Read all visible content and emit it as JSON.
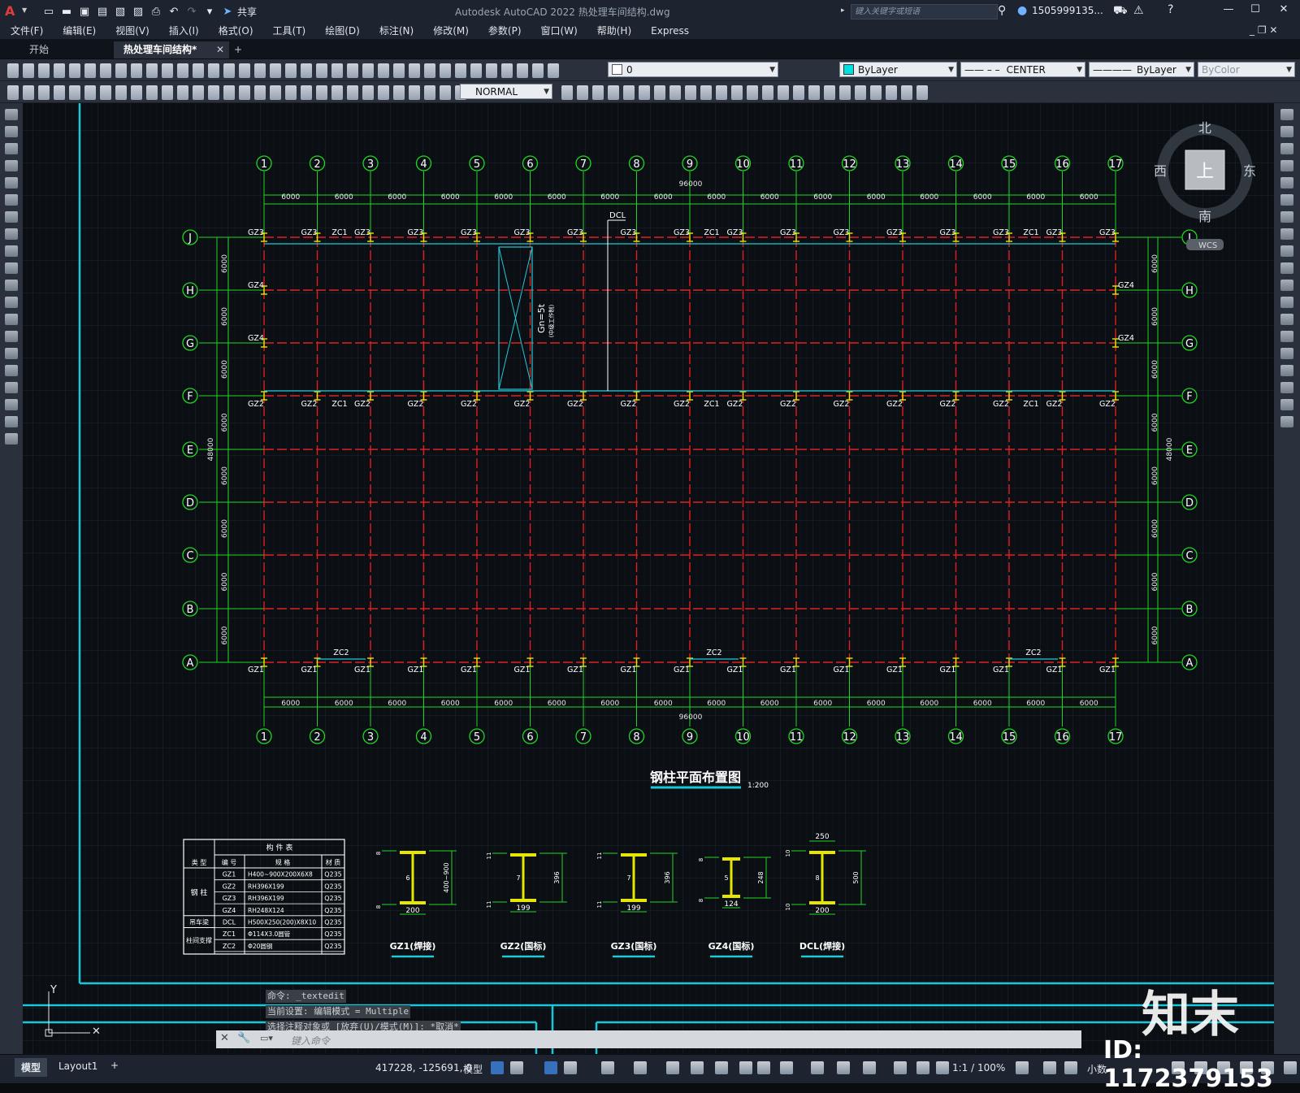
{
  "titlebar": {
    "app_title": "Autodesk AutoCAD 2022    热处理车间结构.dwg",
    "share_label": "共享",
    "search_placeholder": "键入关键字或短语",
    "user_name": "1505999135..."
  },
  "menu": [
    "文件(F)",
    "编辑(E)",
    "视图(V)",
    "插入(I)",
    "格式(O)",
    "工具(T)",
    "绘图(D)",
    "标注(N)",
    "修改(M)",
    "参数(P)",
    "窗口(W)",
    "帮助(H)",
    "Express"
  ],
  "tabs": {
    "start": "开始",
    "active": "热处理车间结构*"
  },
  "toolbar": {
    "layer_value": "0",
    "color_value": "ByLayer",
    "linetype_value": "CENTER",
    "lineweight_value": "ByLayer",
    "plotstyle_value": "ByColor",
    "dimstyle_value": "NORMAL"
  },
  "viewcube": {
    "north": "北",
    "south": "南",
    "east": "东",
    "west": "西",
    "top": "上",
    "wcs": "WCS"
  },
  "drawing": {
    "column_axes": [
      "1",
      "2",
      "3",
      "4",
      "5",
      "6",
      "7",
      "8",
      "9",
      "10",
      "11",
      "12",
      "13",
      "14",
      "15",
      "16",
      "17"
    ],
    "row_axes": [
      "J",
      "H",
      "G",
      "F",
      "E",
      "D",
      "C",
      "B",
      "A"
    ],
    "bay_dim": "6000",
    "total_length": "96000",
    "total_width": "48000",
    "dcl_label": "DCL",
    "crane_label": "Gn=5t",
    "crane_sub": "(中级工作制)",
    "top_labels": [
      "GZ3",
      "GZ3",
      "GZ3",
      "GZ3",
      "GZ3",
      "GZ3",
      "GZ3",
      "GZ3",
      "GZ3",
      "GZ3",
      "GZ3",
      "GZ3",
      "GZ3",
      "GZ3",
      "GZ3",
      "GZ3",
      "GZ3"
    ],
    "zc1": "ZC1",
    "zc2": "ZC2",
    "gz4": "GZ4",
    "f_labels": "GZ2",
    "a_labels": "GZ1",
    "plan_title": "钢柱平面布置图",
    "plan_scale": "1:200",
    "table": {
      "title": "构 件 表",
      "headers": [
        "类 型",
        "编 号",
        "规 格",
        "材 质"
      ],
      "groups": [
        "钢 柱",
        "吊车梁",
        "柱间支撑"
      ],
      "rows": [
        [
          "GZ1",
          "H400~900X200X6X8",
          "Q235"
        ],
        [
          "GZ2",
          "RH396X199",
          "Q235"
        ],
        [
          "GZ3",
          "RH396X199",
          "Q235"
        ],
        [
          "GZ4",
          "RH248X124",
          "Q235"
        ],
        [
          "DCL",
          "H500X250(200)X8X10",
          "Q235"
        ],
        [
          "ZC1",
          "Φ114X3.0圆管",
          "Q235"
        ],
        [
          "ZC2",
          "Φ20圆钢",
          "Q235"
        ]
      ]
    },
    "sections": [
      {
        "name": "GZ1(焊接)",
        "width": "200",
        "height": "400~900",
        "web": "6",
        "flange_top": "8",
        "flange_bot": "8"
      },
      {
        "name": "GZ2(国标)",
        "width": "199",
        "height": "396",
        "web": "7",
        "flange_top": "11",
        "flange_bot": "11"
      },
      {
        "name": "GZ3(国标)",
        "width": "199",
        "height": "396",
        "web": "7",
        "flange_top": "11",
        "flange_bot": "11"
      },
      {
        "name": "GZ4(国标)",
        "width": "124",
        "height": "248",
        "web": "5",
        "flange_top": "8",
        "flange_bot": "8"
      },
      {
        "name": "DCL(焊接)",
        "width": "200",
        "height": "500",
        "web": "8",
        "flange_top": "10",
        "flange_bot": "10",
        "top_width": "250"
      }
    ]
  },
  "command": {
    "history": [
      "命令: _textedit",
      "当前设置: 编辑模式 = Multiple",
      "选择注释对象或 [放弃(U)/模式(M)]: *取消*"
    ],
    "input_placeholder": "键入命令"
  },
  "status": {
    "model_tab": "模型",
    "layout_tab": "Layout1",
    "coords": "417228, -125691, 0",
    "model_btn": "模型",
    "scale": "1:1 / 100%",
    "units": "小数"
  },
  "watermark": {
    "logo": "知末",
    "id": "ID: 1172379153"
  },
  "colors": {
    "axis_green": "#22d422",
    "column_yellow": "#e6e600",
    "beam_red": "#e02020",
    "cyan": "#23c8d4",
    "grid": "#1f2a34"
  }
}
